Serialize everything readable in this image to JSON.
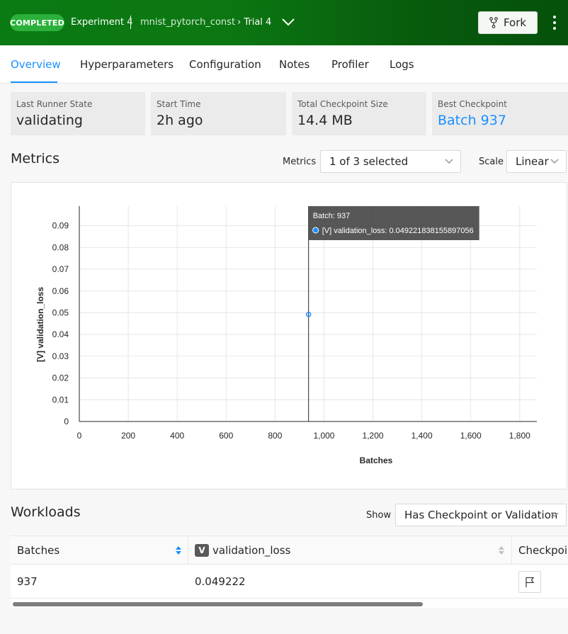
{
  "header": {
    "status_badge": "COMPLETED",
    "experiment": "Experiment 4",
    "project": "mnist_pytorch_const",
    "trial": "Trial 4",
    "fork_label": "Fork",
    "colors": {
      "header_green": "#0c7712",
      "badge_green": "#2bb13b"
    }
  },
  "tabs": [
    {
      "label": "Overview",
      "active": true
    },
    {
      "label": "Hyperparameters"
    },
    {
      "label": "Configuration"
    },
    {
      "label": "Notes"
    },
    {
      "label": "Profiler"
    },
    {
      "label": "Logs"
    }
  ],
  "cards": [
    {
      "label": "Last Runner State",
      "value": "validating"
    },
    {
      "label": "Start Time",
      "value": "2h ago"
    },
    {
      "label": "Total Checkpoint Size",
      "value": "14.4 MB"
    },
    {
      "label": "Best Checkpoint",
      "value": "Batch 937"
    }
  ],
  "metrics": {
    "title": "Metrics",
    "metrics_label": "Metrics",
    "metrics_select": "1 of 3 selected",
    "scale_label": "Scale",
    "scale_select": "Linear"
  },
  "chart_data": {
    "type": "scatter",
    "xlabel": "Batches",
    "ylabel": "[V] validation_loss",
    "xlim": [
      0,
      1870
    ],
    "ylim": [
      0,
      0.099
    ],
    "x_ticks": [
      0,
      200,
      400,
      600,
      800,
      1000,
      1200,
      1400,
      1600,
      1800
    ],
    "x_tick_labels": [
      "0",
      "200",
      "400",
      "600",
      "800",
      "1,000",
      "1,200",
      "1,400",
      "1,600",
      "1,800"
    ],
    "y_ticks": [
      0,
      0.01,
      0.02,
      0.03,
      0.04,
      0.05,
      0.06,
      0.07,
      0.08,
      0.09
    ],
    "y_tick_labels": [
      "0",
      "0.01",
      "0.02",
      "0.03",
      "0.04",
      "0.05",
      "0.06",
      "0.07",
      "0.08",
      "0.09"
    ],
    "grid": true,
    "series": [
      {
        "name": "[V] validation_loss",
        "color": "#1890ff",
        "points": [
          {
            "x": 937,
            "y": 0.049221838155897056
          }
        ]
      }
    ],
    "tooltip": {
      "title": "Batch: 937",
      "entry": "[V] validation_loss: 0.049221838155897056",
      "cursor_x": 937
    }
  },
  "workloads": {
    "title": "Workloads",
    "show_label": "Show",
    "show_select": "Has Checkpoint or Validation",
    "columns": [
      "Batches",
      "validation_loss",
      "Checkpoint"
    ],
    "column_badge": "V",
    "rows": [
      {
        "batches": "937",
        "validation_loss": "0.049222"
      }
    ]
  }
}
